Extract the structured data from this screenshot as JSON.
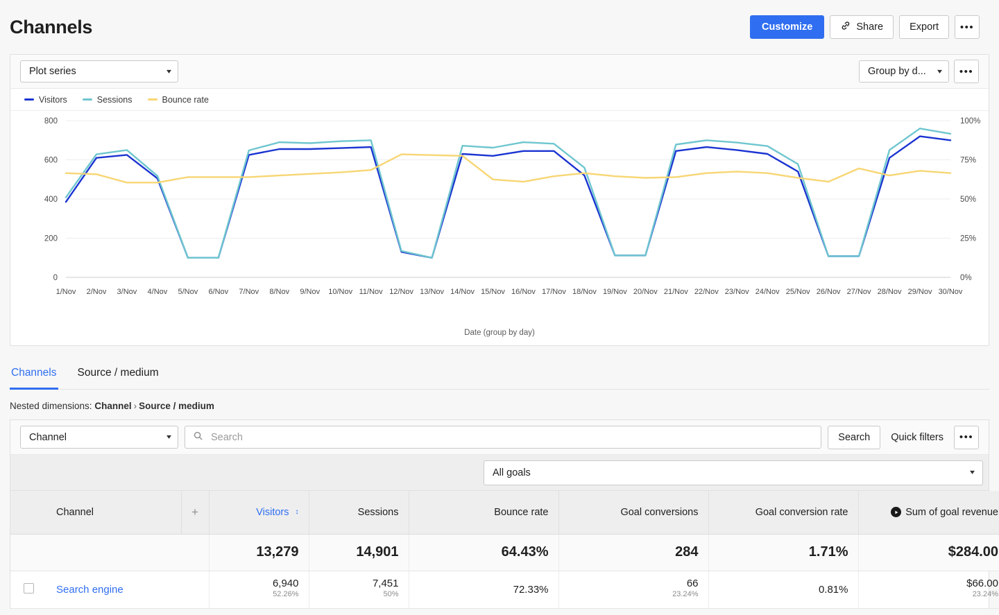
{
  "header": {
    "title": "Channels",
    "customize_label": "Customize",
    "share_label": "Share",
    "export_label": "Export",
    "more_label": "•••",
    "share_icon": "link-icon",
    "accent_color": "#2f6ef0"
  },
  "chart_toolbar": {
    "plot_series_label": "Plot series",
    "group_by_label": "Group by d...",
    "more_label": "•••"
  },
  "chart_data": {
    "type": "line",
    "title": "",
    "xlabel": "Date (group by day)",
    "ylabel": "",
    "grid": true,
    "legend_position": "top-left",
    "x": [
      "1/Nov",
      "2/Nov",
      "3/Nov",
      "4/Nov",
      "5/Nov",
      "6/Nov",
      "7/Nov",
      "8/Nov",
      "9/Nov",
      "10/Nov",
      "11/Nov",
      "12/Nov",
      "13/Nov",
      "14/Nov",
      "15/Nov",
      "16/Nov",
      "17/Nov",
      "18/Nov",
      "19/Nov",
      "20/Nov",
      "21/Nov",
      "22/Nov",
      "23/Nov",
      "24/Nov",
      "25/Nov",
      "26/Nov",
      "27/Nov",
      "28/Nov",
      "29/Nov",
      "30/Nov"
    ],
    "y_left_ticks": [
      0,
      200,
      400,
      600,
      800
    ],
    "y_right_ticks": [
      "0%",
      "25%",
      "50%",
      "75%",
      "100%"
    ],
    "ylim": [
      0,
      800
    ],
    "ylim_right": [
      0,
      100
    ],
    "series": [
      {
        "name": "Visitors",
        "color": "#1b34d1",
        "axis": "left",
        "values": [
          385,
          610,
          625,
          505,
          100,
          100,
          625,
          655,
          655,
          660,
          665,
          130,
          100,
          630,
          620,
          645,
          645,
          520,
          112,
          112,
          645,
          665,
          650,
          630,
          540,
          108,
          108,
          610,
          720,
          700
        ]
      },
      {
        "name": "Sessions",
        "color": "#6fc6cf",
        "axis": "left",
        "values": [
          408,
          628,
          650,
          518,
          100,
          100,
          648,
          690,
          685,
          695,
          700,
          135,
          100,
          672,
          662,
          690,
          682,
          560,
          112,
          112,
          678,
          700,
          688,
          670,
          578,
          108,
          108,
          650,
          760,
          733
        ]
      },
      {
        "name": "Bounce rate",
        "color": "#f7d674",
        "axis": "right",
        "values": [
          66.5,
          65.8,
          60.5,
          60.5,
          64.0,
          64.0,
          64.0,
          65.0,
          66.0,
          67.0,
          68.5,
          78.5,
          78.0,
          77.5,
          62.5,
          61.0,
          64.5,
          66.5,
          64.5,
          63.5,
          64.0,
          66.5,
          67.5,
          66.5,
          63.5,
          61.0,
          69.5,
          65.0,
          68.0,
          66.5
        ]
      }
    ]
  },
  "tabs": [
    {
      "label": "Channels",
      "active": true
    },
    {
      "label": "Source / medium",
      "active": false
    }
  ],
  "nested_dimensions": {
    "prefix": "Nested dimensions:",
    "first": "Channel",
    "separator": "›",
    "second": "Source / medium"
  },
  "filters": {
    "dimension_label": "Channel",
    "search_placeholder": "Search",
    "search_value": "",
    "search_icon": "search-icon",
    "search_button_label": "Search",
    "quick_filters_label": "Quick filters",
    "more_label": "•••",
    "goals_label": "All goals"
  },
  "table": {
    "columns": [
      {
        "label": "Channel",
        "sorted": false
      },
      {
        "label": "+",
        "sorted": false
      },
      {
        "label": "Visitors",
        "sorted": true
      },
      {
        "label": "Sessions",
        "sorted": false
      },
      {
        "label": "Bounce rate",
        "sorted": false
      },
      {
        "label": "Goal conversions",
        "sorted": false
      },
      {
        "label": "Goal conversion rate",
        "sorted": false
      },
      {
        "label": "Sum of goal revenue",
        "sorted": false,
        "icon": "play-circle-icon"
      }
    ],
    "totals": {
      "visitors": "13,279",
      "sessions": "14,901",
      "bounce_rate": "64.43%",
      "goal_conversions": "284",
      "goal_conversion_rate": "1.71%",
      "goal_revenue": "$284.00"
    },
    "rows": [
      {
        "channel": "Search engine",
        "visitors": "6,940",
        "visitors_pct": "52.26%",
        "sessions": "7,451",
        "sessions_pct": "50%",
        "bounce_rate": "72.33%",
        "goal_conversions": "66",
        "goal_conversions_pct": "23.24%",
        "goal_conversion_rate": "0.81%",
        "goal_revenue": "$66.00",
        "goal_revenue_pct": "23.24%"
      }
    ]
  }
}
